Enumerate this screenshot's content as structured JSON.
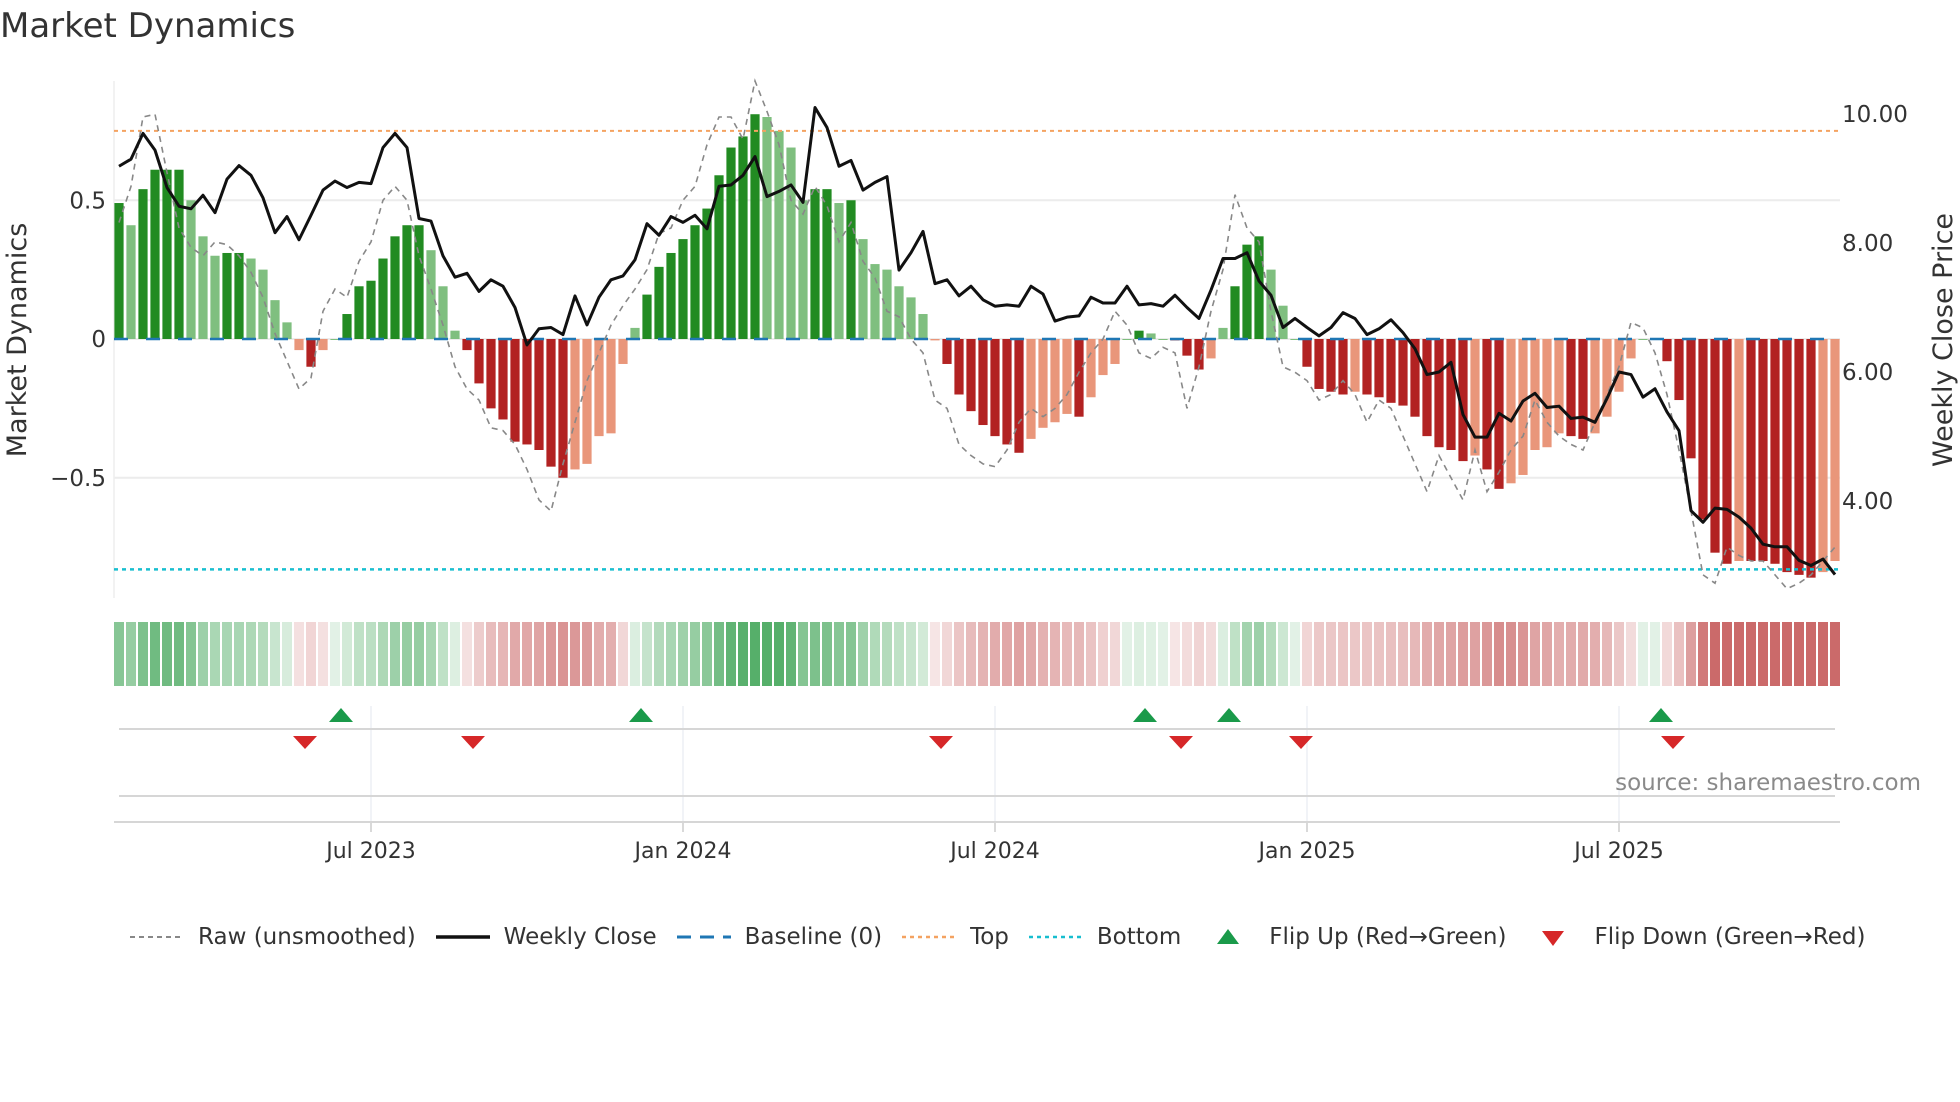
{
  "chart_data": {
    "type": "bar",
    "title": "Market Dynamics",
    "ylabel": "Market Dynamics",
    "ylabel_right": "Weekly Close Price",
    "ylim": [
      -0.93,
      0.93
    ],
    "ylim_right": [
      2.6,
      10.4
    ],
    "yticks": [
      {
        "v": 0.5,
        "label": "0.5"
      },
      {
        "v": 0,
        "label": "0"
      },
      {
        "v": -0.5,
        "label": "−0.5"
      }
    ],
    "yticks_right": [
      {
        "v": 10,
        "label": "10.00"
      },
      {
        "v": 8,
        "label": "8.00"
      },
      {
        "v": 6,
        "label": "6.00"
      },
      {
        "v": 4,
        "label": "4.00"
      }
    ],
    "start_week": "2023-02-06",
    "frequency": "weekly",
    "xticks": [
      {
        "week": 21,
        "label": "Jul 2023"
      },
      {
        "week": 47,
        "label": "Jan 2024"
      },
      {
        "week": 73,
        "label": "Jul 2024"
      },
      {
        "week": 99,
        "label": "Jan 2025"
      },
      {
        "week": 125,
        "label": "Jul 2025"
      }
    ],
    "top_level": 0.75,
    "bottom_level": -0.83,
    "baseline": 0,
    "colors": {
      "green_strong": "#228b22",
      "green_weak": "#7fbf7f",
      "red_strong": "#b22222",
      "red_weak": "#e9967a",
      "raw": "#888888",
      "close": "#111111",
      "baseline": "#1f77b4",
      "top": "#f4a261",
      "bottom": "#17becf",
      "flip_up": "#1a9a4a",
      "flip_down": "#d62728"
    },
    "smoothed": [
      0.49,
      0.41,
      0.54,
      0.61,
      0.61,
      0.61,
      0.5,
      0.37,
      0.3,
      0.31,
      0.31,
      0.29,
      0.25,
      0.14,
      0.06,
      -0.04,
      -0.1,
      -0.04,
      0.0,
      0.09,
      0.19,
      0.21,
      0.29,
      0.37,
      0.41,
      0.41,
      0.32,
      0.19,
      0.03,
      -0.04,
      -0.16,
      -0.25,
      -0.29,
      -0.37,
      -0.38,
      -0.4,
      -0.46,
      -0.5,
      -0.47,
      -0.45,
      -0.35,
      -0.34,
      -0.09,
      0.04,
      0.16,
      0.26,
      0.31,
      0.36,
      0.41,
      0.47,
      0.59,
      0.69,
      0.73,
      0.81,
      0.8,
      0.75,
      0.69,
      0.5,
      0.54,
      0.54,
      0.49,
      0.5,
      0.36,
      0.27,
      0.25,
      0.19,
      0.15,
      0.09,
      -0.005,
      -0.09,
      -0.2,
      -0.26,
      -0.31,
      -0.35,
      -0.38,
      -0.41,
      -0.36,
      -0.32,
      -0.3,
      -0.27,
      -0.28,
      -0.21,
      -0.13,
      -0.09,
      0.0,
      0.03,
      0.02,
      0.0,
      -0.005,
      -0.06,
      -0.11,
      -0.07,
      0.04,
      0.19,
      0.34,
      0.37,
      0.25,
      0.12,
      0.0,
      -0.1,
      -0.18,
      -0.19,
      -0.2,
      -0.19,
      -0.2,
      -0.21,
      -0.23,
      -0.24,
      -0.28,
      -0.35,
      -0.39,
      -0.4,
      -0.44,
      -0.42,
      -0.47,
      -0.54,
      -0.52,
      -0.49,
      -0.4,
      -0.39,
      -0.34,
      -0.35,
      -0.36,
      -0.34,
      -0.28,
      -0.19,
      -0.07,
      0.0,
      0.0,
      -0.08,
      -0.22,
      -0.43,
      -0.65,
      -0.77,
      -0.81,
      -0.8,
      -0.8,
      -0.8,
      -0.81,
      -0.84,
      -0.85,
      -0.86,
      -0.84,
      -0.8
    ],
    "raw": [
      0.42,
      0.55,
      0.8,
      0.81,
      0.6,
      0.4,
      0.33,
      0.3,
      0.35,
      0.34,
      0.3,
      0.24,
      0.15,
      0.02,
      -0.08,
      -0.18,
      -0.14,
      0.1,
      0.18,
      0.15,
      0.28,
      0.35,
      0.5,
      0.55,
      0.5,
      0.3,
      0.18,
      0.05,
      -0.1,
      -0.18,
      -0.22,
      -0.32,
      -0.33,
      -0.38,
      -0.47,
      -0.58,
      -0.62,
      -0.45,
      -0.3,
      -0.15,
      -0.05,
      0.05,
      0.12,
      0.18,
      0.25,
      0.38,
      0.4,
      0.5,
      0.55,
      0.7,
      0.8,
      0.8,
      0.72,
      0.93,
      0.82,
      0.7,
      0.5,
      0.45,
      0.55,
      0.48,
      0.35,
      0.42,
      0.28,
      0.22,
      0.1,
      0.08,
      0.0,
      -0.05,
      -0.22,
      -0.25,
      -0.38,
      -0.42,
      -0.45,
      -0.46,
      -0.4,
      -0.3,
      -0.25,
      -0.28,
      -0.25,
      -0.2,
      -0.12,
      -0.05,
      0.0,
      0.1,
      0.05,
      -0.05,
      -0.07,
      -0.03,
      -0.05,
      -0.25,
      -0.1,
      0.1,
      0.25,
      0.52,
      0.4,
      0.35,
      0.1,
      -0.1,
      -0.12,
      -0.15,
      -0.22,
      -0.2,
      -0.15,
      -0.2,
      -0.3,
      -0.22,
      -0.25,
      -0.35,
      -0.45,
      -0.55,
      -0.42,
      -0.5,
      -0.58,
      -0.4,
      -0.55,
      -0.48,
      -0.4,
      -0.35,
      -0.22,
      -0.3,
      -0.35,
      -0.38,
      -0.4,
      -0.3,
      -0.2,
      -0.1,
      0.06,
      0.04,
      -0.05,
      -0.2,
      -0.4,
      -0.62,
      -0.85,
      -0.88,
      -0.75,
      -0.78,
      -0.8,
      -0.8,
      -0.85,
      -0.9,
      -0.88,
      -0.85,
      -0.8,
      -0.75
    ],
    "close": [
      9.19,
      9.3,
      9.7,
      9.44,
      8.86,
      8.57,
      8.53,
      8.74,
      8.47,
      8.99,
      9.2,
      9.05,
      8.7,
      8.16,
      8.41,
      8.05,
      8.43,
      8.82,
      8.96,
      8.86,
      8.94,
      8.92,
      9.48,
      9.7,
      9.48,
      8.38,
      8.34,
      7.8,
      7.47,
      7.53,
      7.25,
      7.43,
      7.33,
      7.0,
      6.42,
      6.67,
      6.69,
      6.58,
      7.18,
      6.73,
      7.16,
      7.43,
      7.49,
      7.74,
      8.3,
      8.12,
      8.41,
      8.32,
      8.43,
      8.22,
      8.88,
      8.9,
      9.05,
      9.34,
      8.72,
      8.8,
      8.9,
      8.63,
      10.1,
      9.79,
      9.19,
      9.28,
      8.82,
      8.94,
      9.03,
      7.58,
      7.85,
      8.18,
      7.37,
      7.43,
      7.18,
      7.33,
      7.12,
      7.02,
      7.04,
      7.02,
      7.33,
      7.21,
      6.79,
      6.85,
      6.87,
      7.16,
      7.07,
      7.07,
      7.33,
      7.04,
      7.06,
      7.02,
      7.19,
      7.0,
      6.83,
      7.27,
      7.76,
      7.76,
      7.85,
      7.41,
      7.19,
      6.69,
      6.83,
      6.69,
      6.56,
      6.69,
      6.92,
      6.83,
      6.58,
      6.67,
      6.81,
      6.61,
      6.36,
      5.96,
      6.0,
      6.15,
      5.34,
      4.99,
      4.99,
      5.36,
      5.24,
      5.55,
      5.67,
      5.45,
      5.47,
      5.28,
      5.3,
      5.22,
      5.59,
      6.0,
      5.96,
      5.61,
      5.74,
      5.38,
      5.09,
      3.85,
      3.67,
      3.89,
      3.87,
      3.75,
      3.58,
      3.33,
      3.29,
      3.29,
      3.08,
      3.0,
      3.1,
      2.86
    ],
    "flip_up_weeks": [
      18,
      43,
      85,
      92,
      128
    ],
    "flip_down_weeks": [
      15,
      29,
      68,
      88,
      98,
      129
    ],
    "legend": [
      "Raw (unsmoothed)",
      "Weekly Close",
      "Baseline (0)",
      "Top",
      "Bottom",
      "Flip Up (Red→Green)",
      "Flip Down (Green→Red)"
    ],
    "legend_placement": "bottom",
    "source": "source: sharemaestro.com"
  }
}
